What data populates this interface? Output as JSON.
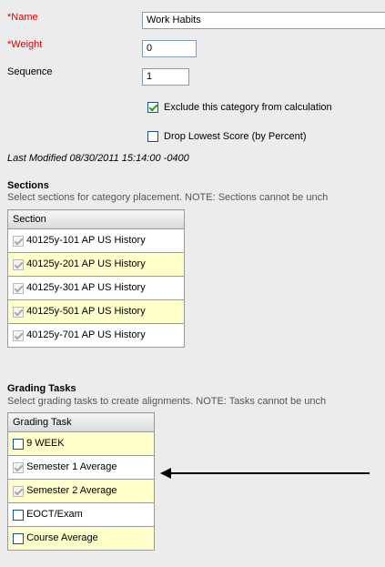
{
  "form": {
    "name_label": "*Name",
    "name_value": "Work Habits",
    "weight_label": "*Weight",
    "weight_value": "0",
    "sequence_label": "Sequence",
    "sequence_value": "1",
    "exclude_label": "Exclude this category from calculation",
    "exclude_checked": true,
    "drop_lowest_label": "Drop Lowest Score (by Percent)",
    "drop_lowest_checked": false,
    "last_modified": "Last Modified 08/30/2011 15:14:00 -0400"
  },
  "sections": {
    "title": "Sections",
    "note": "Select sections for category placement. NOTE: Sections cannot be unch",
    "header": "Section",
    "rows": [
      {
        "label": "40125y-101 AP US History",
        "checked": true,
        "disabled": true
      },
      {
        "label": "40125y-201 AP US History",
        "checked": true,
        "disabled": true
      },
      {
        "label": "40125y-301 AP US History",
        "checked": true,
        "disabled": true
      },
      {
        "label": "40125y-501 AP US History",
        "checked": true,
        "disabled": true
      },
      {
        "label": "40125y-701 AP US History",
        "checked": true,
        "disabled": true
      }
    ]
  },
  "grading_tasks": {
    "title": "Grading Tasks",
    "note": "Select grading tasks to create alignments. NOTE: Tasks cannot be unch",
    "header": "Grading Task",
    "rows": [
      {
        "label": "9 WEEK",
        "checked": false,
        "disabled": false
      },
      {
        "label": "Semester 1 Average",
        "checked": true,
        "disabled": true
      },
      {
        "label": "Semester 2 Average",
        "checked": true,
        "disabled": true
      },
      {
        "label": "EOCT/Exam",
        "checked": false,
        "disabled": false
      },
      {
        "label": "Course Average",
        "checked": false,
        "disabled": false
      }
    ]
  },
  "annotation": {
    "arrow": "arrow-pointing-left-icon"
  },
  "colors": {
    "required": "#e00000",
    "row_highlight": "#ffffcc",
    "check": "#21a121"
  }
}
